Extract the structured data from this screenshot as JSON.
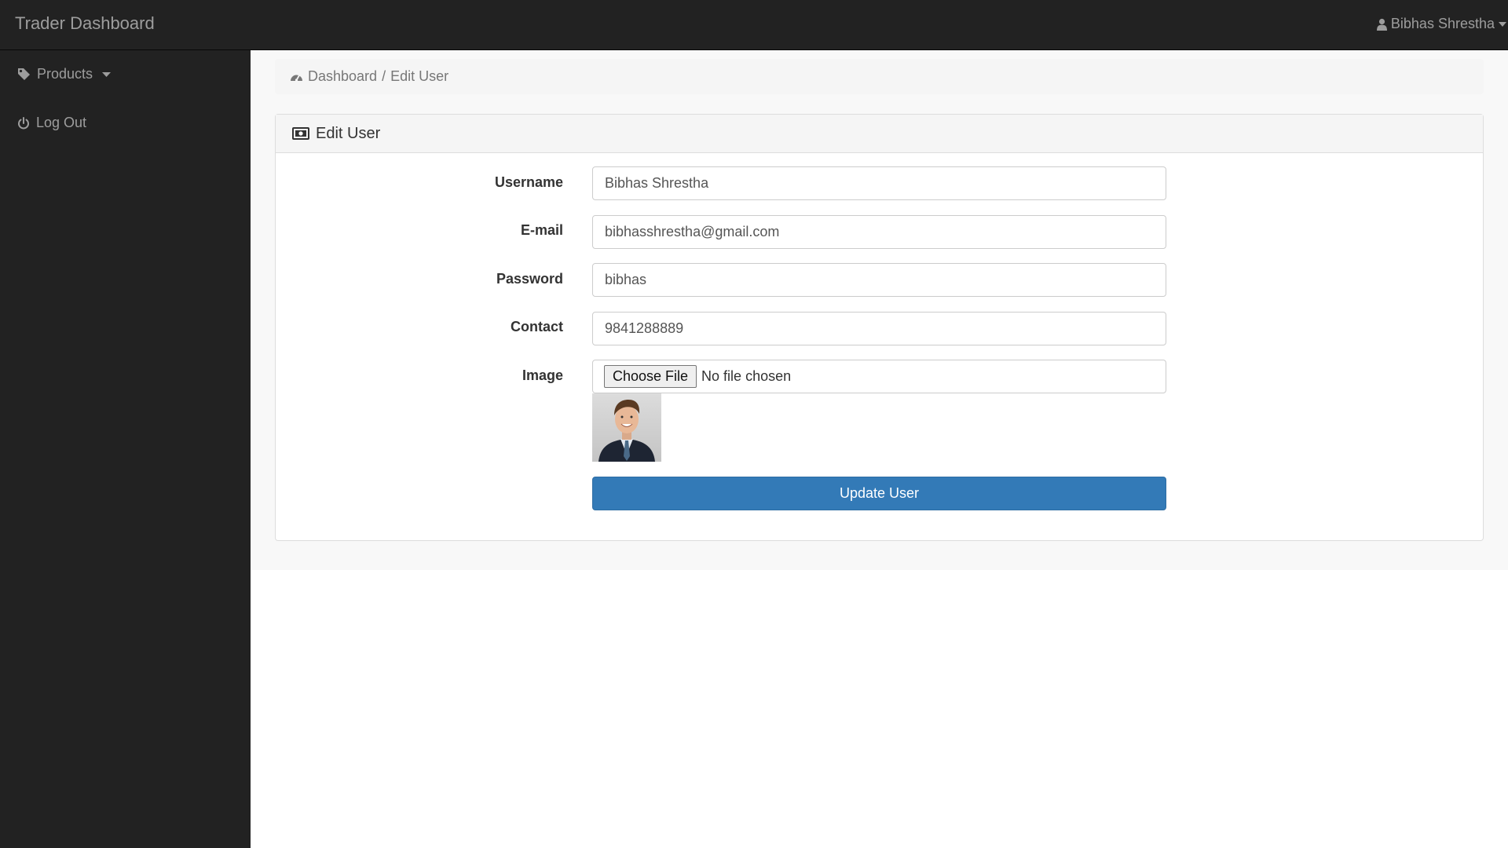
{
  "navbar": {
    "brand": "Trader Dashboard",
    "user_name": "Bibhas Shrestha"
  },
  "sidebar": {
    "items": [
      {
        "label": "Products",
        "icon": "tag-icon",
        "has_dropdown": true
      },
      {
        "label": "Log Out",
        "icon": "power-icon",
        "has_dropdown": false
      }
    ]
  },
  "breadcrumb": {
    "home": "Dashboard",
    "separator": "/",
    "current": "Edit User"
  },
  "panel": {
    "title": "Edit User",
    "icon": "money-icon"
  },
  "form": {
    "username": {
      "label": "Username",
      "value": "Bibhas Shrestha"
    },
    "email": {
      "label": "E-mail",
      "value": "bibhasshrestha@gmail.com"
    },
    "password": {
      "label": "Password",
      "value": "bibhas"
    },
    "contact": {
      "label": "Contact",
      "value": "9841288889"
    },
    "image": {
      "label": "Image",
      "button": "Choose File",
      "status": "No file chosen"
    },
    "submit": "Update User"
  },
  "colors": {
    "navbar_bg": "#222222",
    "primary": "#337ab7"
  }
}
